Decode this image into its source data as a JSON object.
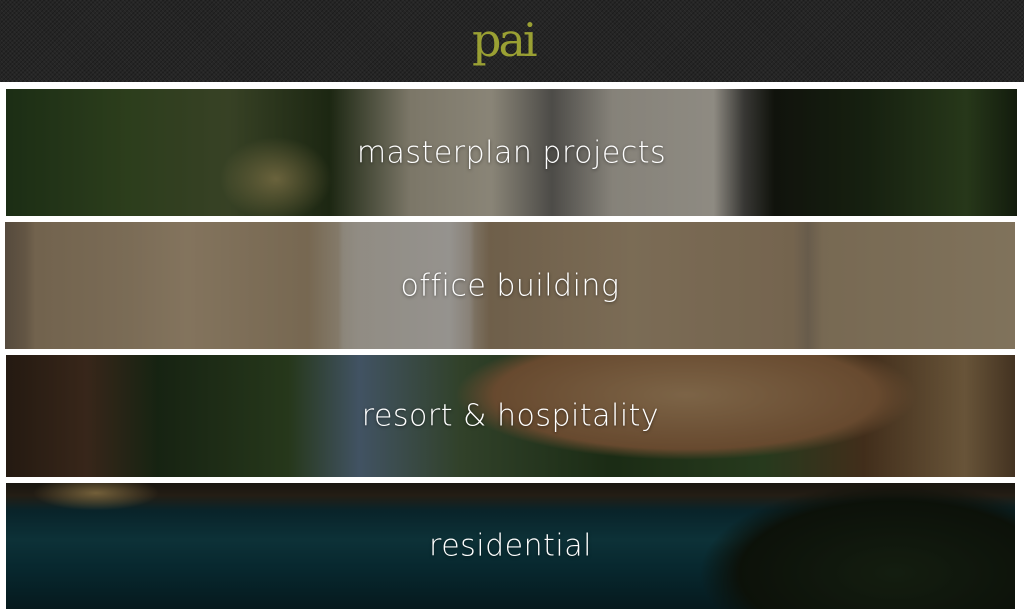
{
  "header": {
    "logo_text": "pai"
  },
  "categories": [
    {
      "label": "masterplan projects"
    },
    {
      "label": "office building"
    },
    {
      "label": "resort & hospitality"
    },
    {
      "label": "residential"
    }
  ]
}
